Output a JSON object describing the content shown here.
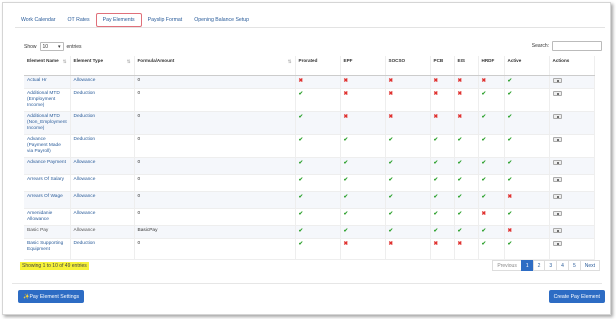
{
  "tabs": [
    {
      "label": "Work Calendar",
      "active": false
    },
    {
      "label": "OT Rates",
      "active": false
    },
    {
      "label": "Pay Elements",
      "active": true
    },
    {
      "label": "Payslip Format",
      "active": false
    },
    {
      "label": "Opening Balance Setup",
      "active": false
    }
  ],
  "length_control": {
    "prefix": "Show",
    "value": "10",
    "suffix": "entries"
  },
  "search": {
    "label": "Search:",
    "value": ""
  },
  "table": {
    "headers": [
      "Element Name",
      "Element Type",
      "Formula/Amount",
      "Prorated",
      "EPF",
      "SOCSO",
      "PCB",
      "EIS",
      "HRDF",
      "Active",
      "Actions"
    ],
    "rows": [
      {
        "name": "Actual Hr",
        "type": "Allowance",
        "formula": "0",
        "flags": [
          0,
          0,
          0,
          0,
          0,
          0,
          1
        ]
      },
      {
        "name": "Additional MTD (Employment Income)",
        "type": "Deduction",
        "formula": "0",
        "flags": [
          1,
          0,
          0,
          0,
          0,
          1,
          1
        ]
      },
      {
        "name": "Additional MTD (Non_Employment Income)",
        "type": "Deduction",
        "formula": "0",
        "flags": [
          1,
          0,
          0,
          0,
          0,
          1,
          1
        ]
      },
      {
        "name": "Advance (Payment Made via Payroll)",
        "type": "Deduction",
        "formula": "0",
        "flags": [
          1,
          1,
          1,
          1,
          1,
          1,
          1
        ]
      },
      {
        "name": "Advance Payment",
        "type": "Allowance",
        "formula": "0",
        "flags": [
          1,
          1,
          1,
          1,
          1,
          1,
          1
        ]
      },
      {
        "name": "Arrears Of Salary",
        "type": "Allowance",
        "formula": "0",
        "flags": [
          1,
          1,
          1,
          1,
          1,
          1,
          1
        ]
      },
      {
        "name": "Arrears Of Wage",
        "type": "Allowance",
        "formula": "0",
        "flags": [
          1,
          1,
          1,
          1,
          1,
          1,
          0
        ]
      },
      {
        "name": "Amenidanie Allowance",
        "type": "Allowance",
        "formula": "0",
        "flags": [
          1,
          1,
          1,
          1,
          1,
          0,
          1
        ]
      },
      {
        "name": "Basic Pay",
        "type": "Allowance",
        "formula": "BasicPay",
        "flags": [
          1,
          1,
          1,
          1,
          1,
          1,
          0
        ],
        "plain": true
      },
      {
        "name": "Basic Supporting Equipment",
        "type": "Deduction",
        "formula": "0",
        "flags": [
          1,
          0,
          0,
          0,
          0,
          1,
          1
        ]
      }
    ]
  },
  "info": "Showing 1 to 10 of 49 entries",
  "pagination": [
    "Previous",
    "1",
    "2",
    "3",
    "4",
    "5",
    "Next"
  ],
  "buttons": {
    "settings": "✨Pay Element Settings",
    "create": "Create Pay Element"
  },
  "colors": {
    "accent": "#2d6cc4",
    "check": "#2ca02c",
    "cross": "#e0312f",
    "highlight": "#f6f238"
  }
}
